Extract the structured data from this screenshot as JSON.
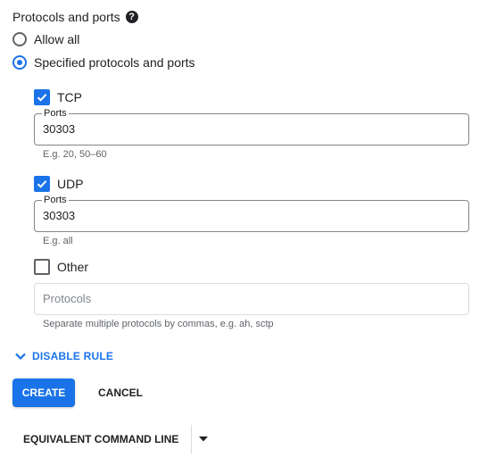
{
  "section": {
    "title": "Protocols and ports",
    "help_icon": "?"
  },
  "radio": {
    "allow_all": "Allow all",
    "specified": "Specified protocols and ports",
    "selected": "specified"
  },
  "tcp": {
    "label": "TCP",
    "checked": true,
    "ports_label": "Ports",
    "ports_value": "30303",
    "hint": "E.g. 20, 50–60"
  },
  "udp": {
    "label": "UDP",
    "checked": true,
    "ports_label": "Ports",
    "ports_value": "30303",
    "hint": "E.g. all"
  },
  "other": {
    "label": "Other",
    "checked": false,
    "protocols_placeholder": "Protocols",
    "hint": "Separate multiple protocols by commas, e.g. ah, sctp"
  },
  "actions": {
    "disable_rule": "DISABLE RULE",
    "create": "CREATE",
    "cancel": "CANCEL",
    "equivalent_command_line": "EQUIVALENT COMMAND LINE"
  },
  "colors": {
    "accent": "#1a73e8",
    "text": "#202124",
    "muted": "#5f6368"
  },
  "icons": {
    "help": "help-circle-icon",
    "check": "check-icon",
    "chevron": "chevron-down-icon",
    "dropdown": "arrow-drop-down-icon"
  }
}
